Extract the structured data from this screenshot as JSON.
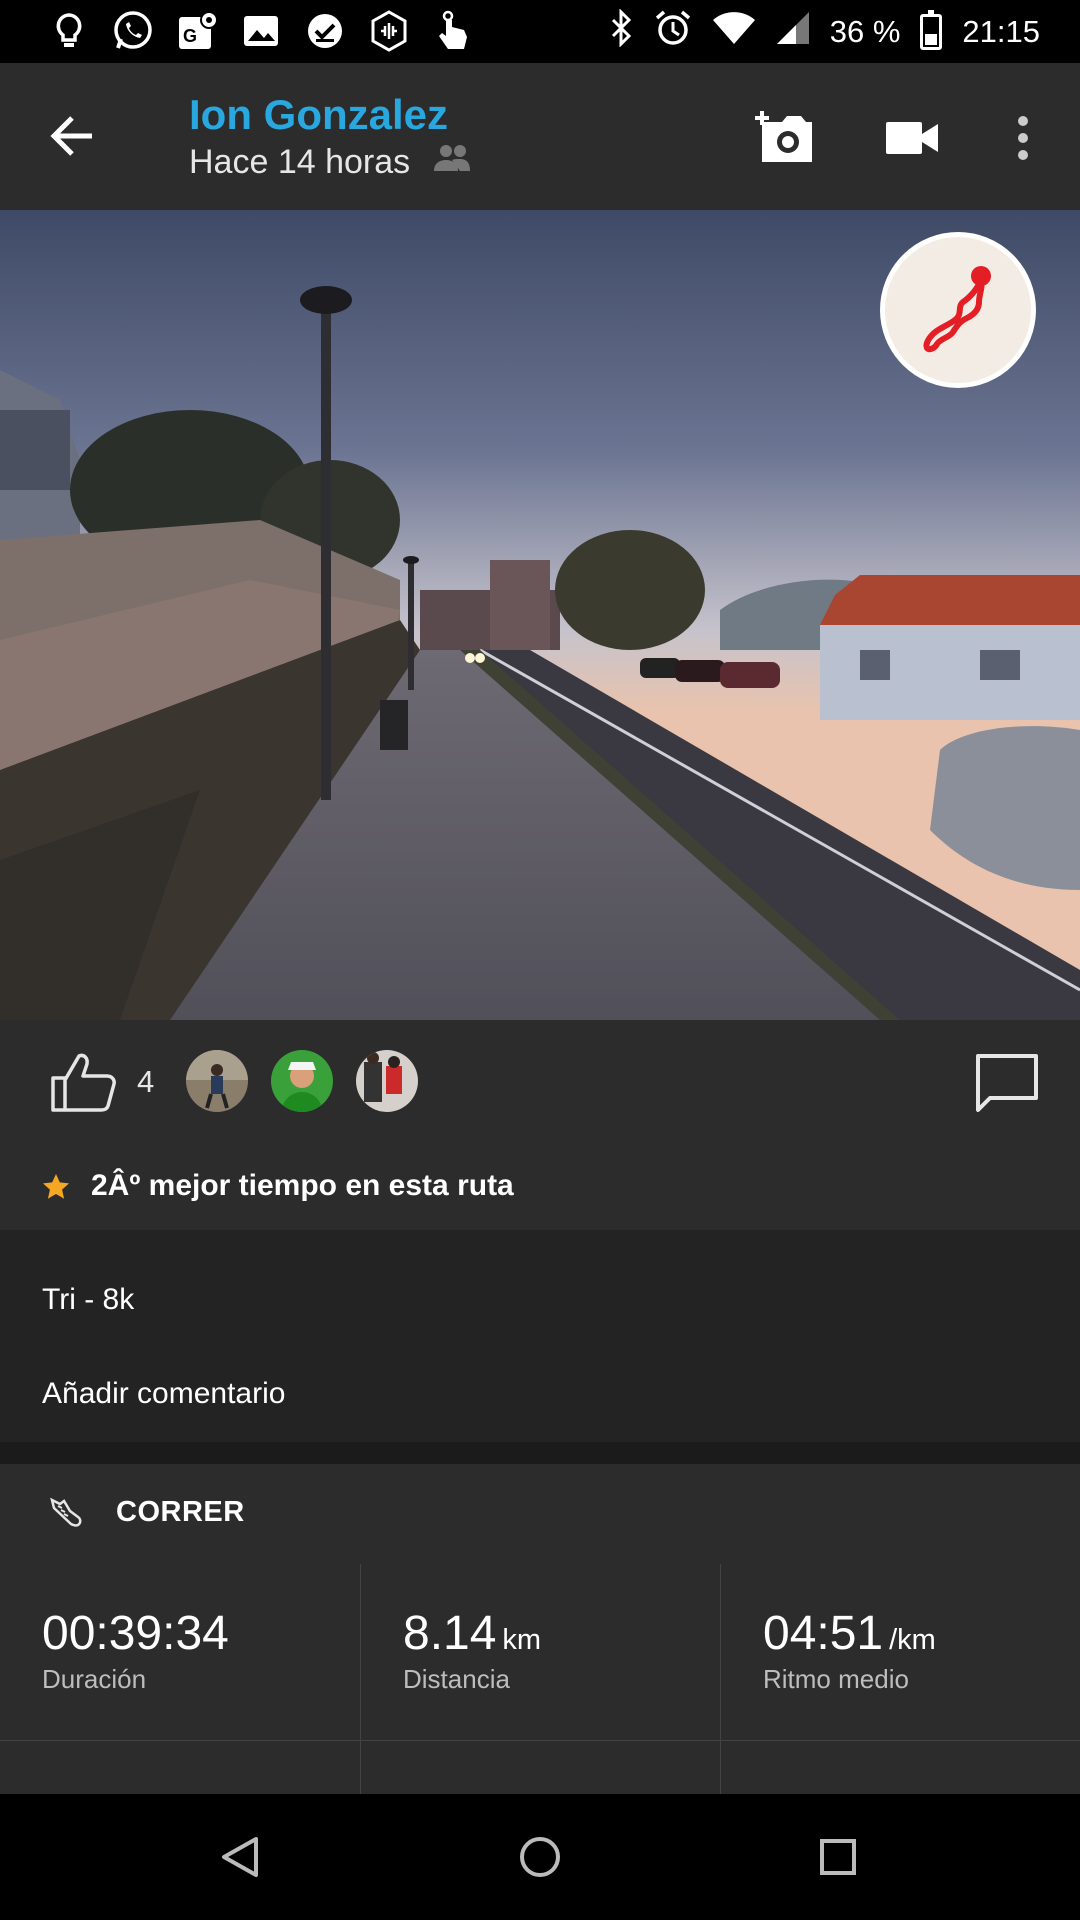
{
  "status_bar": {
    "battery": "36 %",
    "battery_level": 0.36,
    "time": "21:15",
    "left_icons": [
      "bulb-icon",
      "whatsapp-icon",
      "maps-icon",
      "gallery-icon",
      "tasks-icon",
      "podcast-icon",
      "touch-icon"
    ],
    "right_icons": [
      "bluetooth-icon",
      "alarm-icon",
      "wifi-icon",
      "signal-icon",
      "battery-icon"
    ]
  },
  "header": {
    "user_name": "Ion Gonzalez",
    "time_ago": "Hace 14 horas",
    "visibility_icon": "people-icon",
    "actions": [
      "add-photo-icon",
      "video-icon",
      "more-icon"
    ]
  },
  "likes": {
    "count": "4",
    "avatars": [
      "avatar-runner",
      "avatar-green",
      "avatar-redshirt"
    ]
  },
  "achievement": {
    "text": "2Âº mejor tiempo en esta ruta",
    "icon": "star-icon",
    "color": "#f5a623"
  },
  "activity": {
    "title": "Tri - 8k",
    "add_comment": "Añadir comentario",
    "type": "CORRER"
  },
  "stats": [
    {
      "value": "00:39:34",
      "unit": "",
      "label": "Duración"
    },
    {
      "value": "8.14",
      "unit": "km",
      "label": "Distancia"
    },
    {
      "value": "04:51",
      "unit": "/km",
      "label": "Ritmo medio"
    }
  ],
  "colors": {
    "accent": "#29a8e0",
    "route": "#e31e24",
    "background": "#2c2c2c"
  }
}
